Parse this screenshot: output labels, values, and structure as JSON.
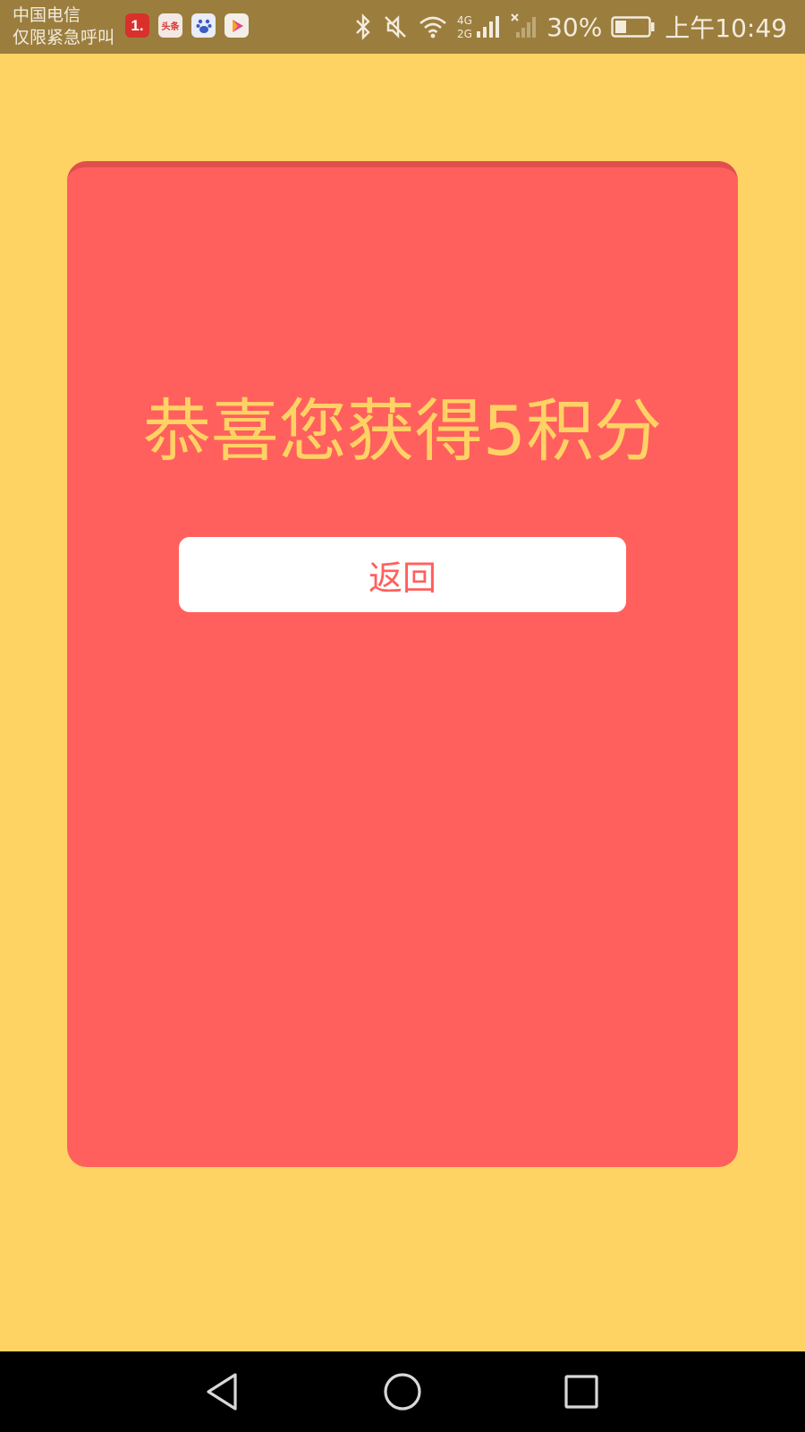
{
  "status_bar": {
    "carrier": "中国电信",
    "carrier_note": "仅限紧急呼叫",
    "app_icons": [
      {
        "name": "app-1-icon",
        "label": "1."
      },
      {
        "name": "toutiao-icon",
        "label": "头条"
      },
      {
        "name": "baidu-icon",
        "label": ""
      },
      {
        "name": "video-app-icon",
        "label": ""
      }
    ],
    "status_icons": [
      "bluetooth-icon",
      "mute-icon",
      "wifi-icon",
      "signal-4g-icon",
      "signal-no-sim-icon",
      "battery-icon"
    ],
    "network_label_top": "4G",
    "network_label_bottom": "2G",
    "battery": "30%",
    "time": "上午10:49"
  },
  "card": {
    "title": "恭喜您获得5积分",
    "back_label": "返回"
  },
  "nav_bar": {
    "items": [
      "back-nav-icon",
      "home-nav-icon",
      "recents-nav-icon"
    ]
  },
  "colors": {
    "background": "#FFD264",
    "card": "#FF605D",
    "card_top_border": "#E04F4E",
    "title": "#FFD264",
    "button_bg": "#FFFFFF",
    "button_text": "#FF605D",
    "status_bar": "#9B7E3E",
    "nav_bar": "#000000"
  }
}
